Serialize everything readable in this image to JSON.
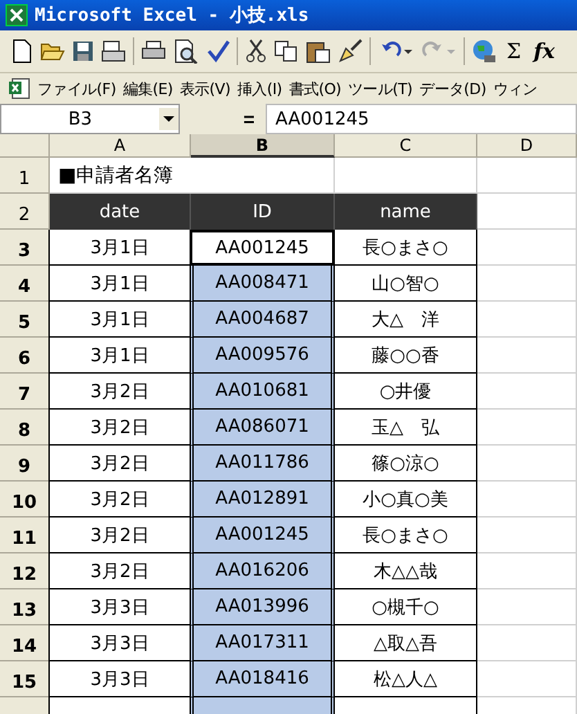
{
  "window": {
    "title": "Microsoft Excel - 小技.xls"
  },
  "toolbar": {
    "sum": "Σ",
    "function": "fx"
  },
  "menu": [
    "ファイル(F)",
    "編集(E)",
    "表示(V)",
    "挿入(I)",
    "書式(O)",
    "ツール(T)",
    "データ(D)",
    "ウィン"
  ],
  "formula_bar": {
    "name_box": "B3",
    "equals": "=",
    "value": "AA001245"
  },
  "columns": [
    {
      "label": "A",
      "selected": false
    },
    {
      "label": "B",
      "selected": true
    },
    {
      "label": "C",
      "selected": false
    },
    {
      "label": "D",
      "selected": false
    }
  ],
  "sheet_title": {
    "row": "1",
    "text": "■申請者名簿"
  },
  "header": {
    "row": "2",
    "cells": [
      "date",
      "ID",
      "name"
    ]
  },
  "rows": [
    {
      "row": "3",
      "date": "3月1日",
      "id": "AA001245",
      "name": "長○まさ○",
      "selected": true,
      "active": true
    },
    {
      "row": "4",
      "date": "3月1日",
      "id": "AA008471",
      "name": "山○智○",
      "selected": true,
      "active": false
    },
    {
      "row": "5",
      "date": "3月1日",
      "id": "AA004687",
      "name": "大△　洋",
      "selected": true,
      "active": false
    },
    {
      "row": "6",
      "date": "3月1日",
      "id": "AA009576",
      "name": "藤○○香",
      "selected": true,
      "active": false
    },
    {
      "row": "7",
      "date": "3月2日",
      "id": "AA010681",
      "name": "○井優",
      "selected": true,
      "active": false
    },
    {
      "row": "8",
      "date": "3月2日",
      "id": "AA086071",
      "name": "玉△　弘",
      "selected": true,
      "active": false
    },
    {
      "row": "9",
      "date": "3月2日",
      "id": "AA011786",
      "name": "篠○涼○",
      "selected": true,
      "active": false
    },
    {
      "row": "10",
      "date": "3月2日",
      "id": "AA012891",
      "name": "小○真○美",
      "selected": true,
      "active": false
    },
    {
      "row": "11",
      "date": "3月2日",
      "id": "AA001245",
      "name": "長○まさ○",
      "selected": true,
      "active": false
    },
    {
      "row": "12",
      "date": "3月2日",
      "id": "AA016206",
      "name": "木△△哉",
      "selected": true,
      "active": false
    },
    {
      "row": "13",
      "date": "3月3日",
      "id": "AA013996",
      "name": "○槻千○",
      "selected": true,
      "active": false
    },
    {
      "row": "14",
      "date": "3月3日",
      "id": "AA017311",
      "name": "△取△吾",
      "selected": true,
      "active": false
    },
    {
      "row": "15",
      "date": "3月3日",
      "id": "AA018416",
      "name": "松△人△",
      "selected": true,
      "active": false
    }
  ]
}
